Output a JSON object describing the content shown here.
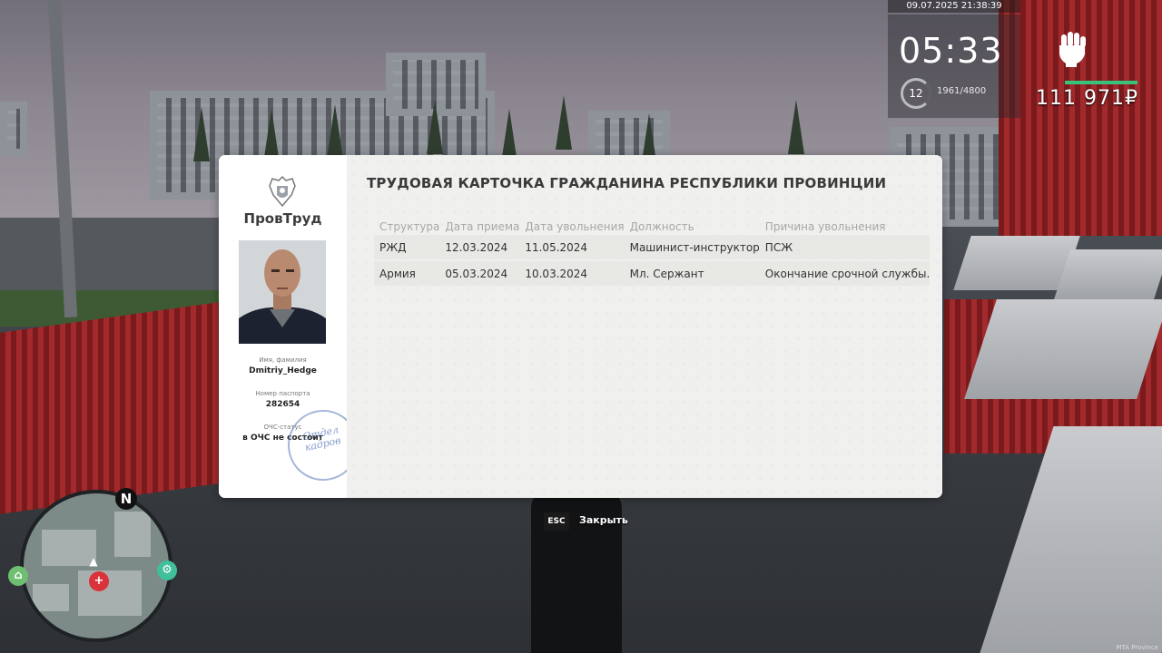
{
  "hud": {
    "datetime": "09.07.2025 21:38:39",
    "clock": "05:33",
    "level": "12",
    "experience": "1961/4800",
    "money": "111 971₽",
    "watermark": "MTA Province",
    "status_icon": "fist-icon",
    "health_color": "#39c27a"
  },
  "minimap": {
    "north_label": "N",
    "icons": [
      "bank-icon",
      "hospital-icon",
      "car-service-icon",
      "player-arrow-icon"
    ]
  },
  "card": {
    "ministry": "ПровТруд",
    "title": "ТРУДОВАЯ КАРТОЧКА ГРАЖДАНИНА РЕСПУБЛИКИ ПРОВИНЦИИ",
    "name_label": "Имя, фамилия",
    "name_value": "Dmitriy_Hedge",
    "passport_label": "Номер паспорта",
    "passport_value": "282654",
    "ochs_label": "ОЧС-статус",
    "ochs_value": "в ОЧС не состоит",
    "stamp_line1": "Отдел",
    "stamp_line2": "кадров",
    "columns": [
      "Структура",
      "Дата приема",
      "Дата увольнения",
      "Должность",
      "Причина увольнения"
    ],
    "rows": [
      [
        "РЖД",
        "12.03.2024",
        "11.05.2024",
        "Машинист-инструктор",
        "ПСЖ"
      ],
      [
        "Армия",
        "05.03.2024",
        "10.03.2024",
        "Мл. Сержант",
        "Окончание срочной службы."
      ]
    ]
  },
  "close_hint": {
    "key": "ESC",
    "label": "Закрыть"
  }
}
